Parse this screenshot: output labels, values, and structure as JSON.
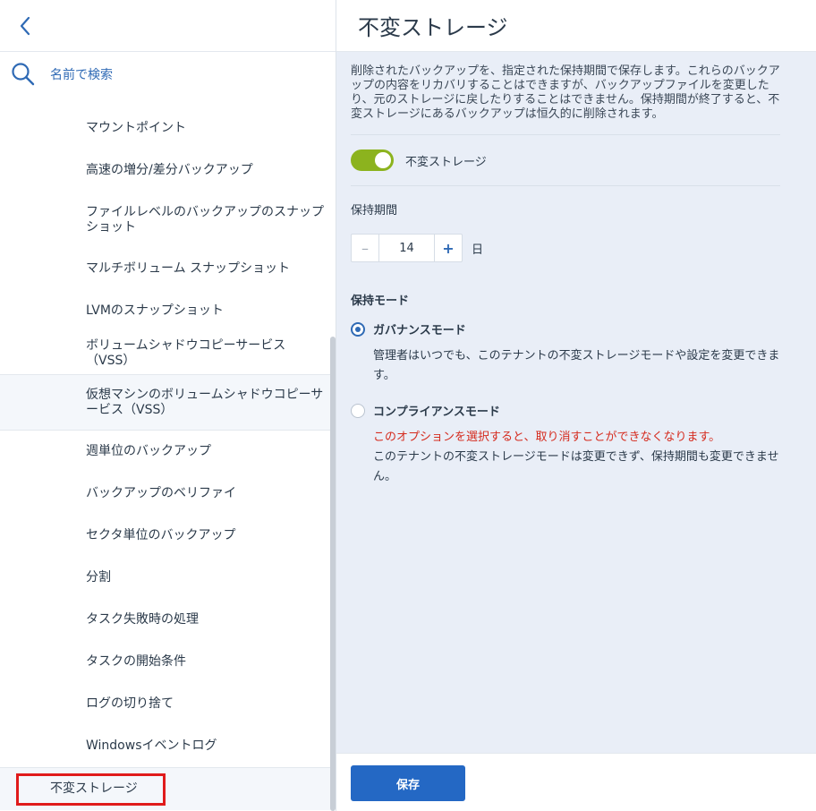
{
  "sidebar": {
    "search_label": "名前で検索",
    "items": [
      {
        "label": "マウントポイント"
      },
      {
        "label": "高速の増分/差分バックアップ"
      },
      {
        "label": "ファイルレベルのバックアップのスナップショット"
      },
      {
        "label": "マルチボリューム スナップショット"
      },
      {
        "label": "LVMのスナップショット"
      },
      {
        "label": "ボリュームシャドウコピーサービス（VSS）"
      },
      {
        "label": "仮想マシンのボリュームシャドウコピーサービス（VSS）"
      },
      {
        "label": "週単位のバックアップ"
      },
      {
        "label": "バックアップのベリファイ"
      },
      {
        "label": "セクタ単位のバックアップ"
      },
      {
        "label": "分割"
      },
      {
        "label": "タスク失敗時の処理"
      },
      {
        "label": "タスクの開始条件"
      },
      {
        "label": "ログの切り捨て"
      },
      {
        "label": "Windowsイベントログ"
      },
      {
        "label": "不変ストレージ"
      }
    ]
  },
  "main": {
    "title": "不変ストレージ",
    "description": "削除されたバックアップを、指定された保持期間で保存します。これらのバックアップの内容をリカバリすることはできますが、バックアップファイルを変更したり、元のストレージに戻したりすることはできません。保持期間が終了すると、不変ストレージにあるバックアップは恒久的に削除されます。",
    "toggle": {
      "label": "不変ストレージ",
      "on": true
    },
    "retention": {
      "label": "保持期間",
      "value": "14",
      "unit": "日",
      "minus": "–",
      "plus": "+"
    },
    "mode_section_title": "保持モード",
    "modes": [
      {
        "label": "ガバナンスモード",
        "checked": true,
        "desc": "管理者はいつでも、このテナントの不変ストレージモードや設定を変更できます。"
      },
      {
        "label": "コンプライアンスモード",
        "checked": false,
        "warning": "このオプションを選択すると、取り消すことができなくなります。",
        "desc": "このテナントの不変ストレージモードは変更できず、保持期間も変更できません。"
      }
    ],
    "save_label": "保存"
  },
  "colors": {
    "accent": "#2468c4",
    "toggle_on": "#8cb31e",
    "warning": "#d52b1e",
    "highlight_box": "#e01b1b"
  }
}
